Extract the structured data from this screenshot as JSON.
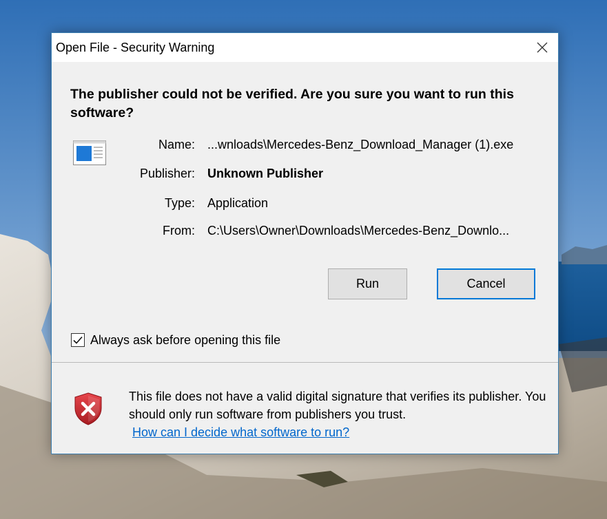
{
  "dialog": {
    "title": "Open File - Security Warning",
    "close_icon": "close-icon",
    "heading": "The publisher could not be verified.  Are you sure you want to run this software?",
    "app_icon": "application-icon",
    "fields": {
      "name_label": "Name:",
      "name_value": "...wnloads\\Mercedes-Benz_Download_Manager (1).exe",
      "publisher_label": "Publisher:",
      "publisher_value": "Unknown Publisher",
      "type_label": "Type:",
      "type_value": "Application",
      "from_label": "From:",
      "from_value": "C:\\Users\\Owner\\Downloads\\Mercedes-Benz_Downlo..."
    },
    "buttons": {
      "run_label": "Run",
      "cancel_label": "Cancel"
    },
    "checkbox": {
      "label": "Always ask before opening this file",
      "checked": true
    },
    "footer": {
      "shield_icon": "security-shield-error-icon",
      "message": "This file does not have a valid digital signature that verifies its publisher.  You should only run software from publishers you trust.",
      "link_text": "How can I decide what software to run?"
    }
  },
  "colors": {
    "accent": "#0078d7",
    "link": "#0066cc",
    "panel": "#f0f0f0",
    "shield_red": "#c9242b"
  }
}
